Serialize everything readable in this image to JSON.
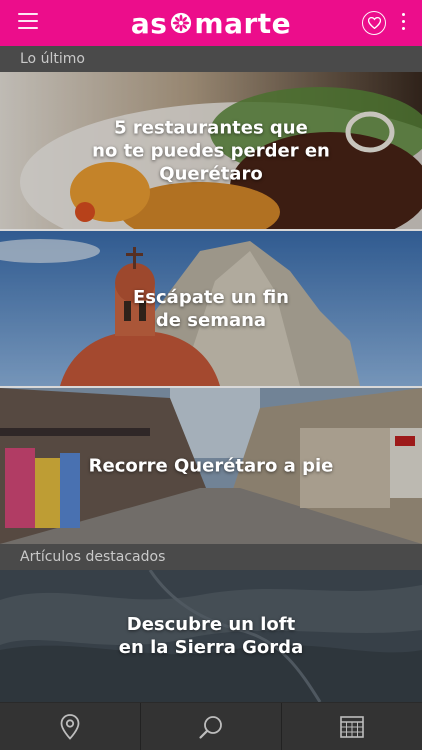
{
  "app": {
    "logo_left": "as",
    "logo_right": "marte"
  },
  "colors": {
    "brand": "#ec0d8b",
    "section_bar": "#4a4a4a",
    "bottom_bar": "#333333"
  },
  "icons": [
    "menu-icon",
    "logo-flower-icon",
    "heart-icon",
    "more-vertical-icon",
    "map-pin-icon",
    "search-icon",
    "calendar-icon"
  ],
  "sections": {
    "latest": "Lo último",
    "featured": "Artículos destacados"
  },
  "cards": [
    {
      "title": "5 restaurantes que\nno te puedes perder en\nQuerétaro"
    },
    {
      "title": "Escápate un fin\nde semana"
    },
    {
      "title": "Recorre Querétaro a pie"
    },
    {
      "title": "Descubre un loft\nen la Sierra Gorda"
    }
  ]
}
